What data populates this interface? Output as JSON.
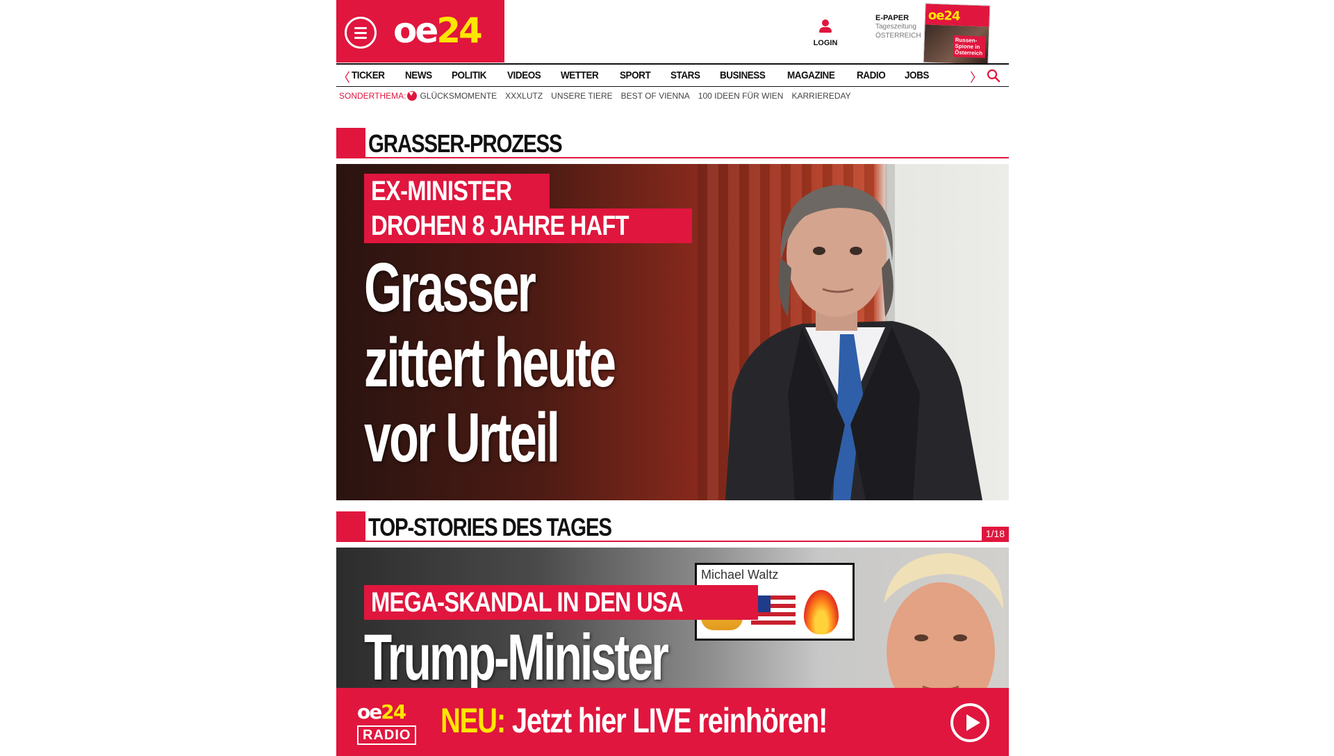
{
  "brand": {
    "logo_oe": "oe",
    "logo_24": "24",
    "accent": "#e0163e",
    "yellow": "#ffe600"
  },
  "header": {
    "login_label": "LOGIN",
    "epaper_title": "E-PAPER",
    "epaper_sub1": "Tageszeitung",
    "epaper_sub2": "ÖSTERREICH",
    "epaper_thumb_logo": "oe24",
    "epaper_thumb_caption": "Russen-Spione in Österreich"
  },
  "nav": {
    "items": [
      "TICKER",
      "NEWS",
      "POLITIK",
      "VIDEOS",
      "WETTER",
      "SPORT",
      "STARS",
      "BUSINESS",
      "MAGAZINE",
      "RADIO",
      "JOBS"
    ],
    "prev_arrow": "〈",
    "next_arrow": "〉"
  },
  "subnav": {
    "lead": "SONDERTHEMA:",
    "links": [
      "GLÜCKSMOMENTE",
      "XXXLUTZ",
      "UNSERE TIERE",
      "BEST OF VIENNA",
      "100 IDEEN FÜR WIEN",
      "KARRIEREDAY"
    ]
  },
  "section1": {
    "title": "GRASSER-PROZESS"
  },
  "hero1": {
    "kicker_line1": "EX-MINISTER",
    "kicker_line2": "DROHEN 8 JAHRE HAFT",
    "headline_line1": "Grasser",
    "headline_line2": "zittert heute",
    "headline_line3": "vor Urteil"
  },
  "section2": {
    "title": "TOP-STORIES DES TAGES",
    "counter": "1/18"
  },
  "hero2": {
    "kicker": "MEGA-SKANDAL IN DEN USA",
    "headline": "Trump-Minister",
    "tweet_name": "Michael Waltz"
  },
  "radio": {
    "logo_oe": "oe",
    "logo_24": "24",
    "badge": "RADIO",
    "neu": "NEU:",
    "text": " Jetzt hier LIVE reinhören!"
  }
}
